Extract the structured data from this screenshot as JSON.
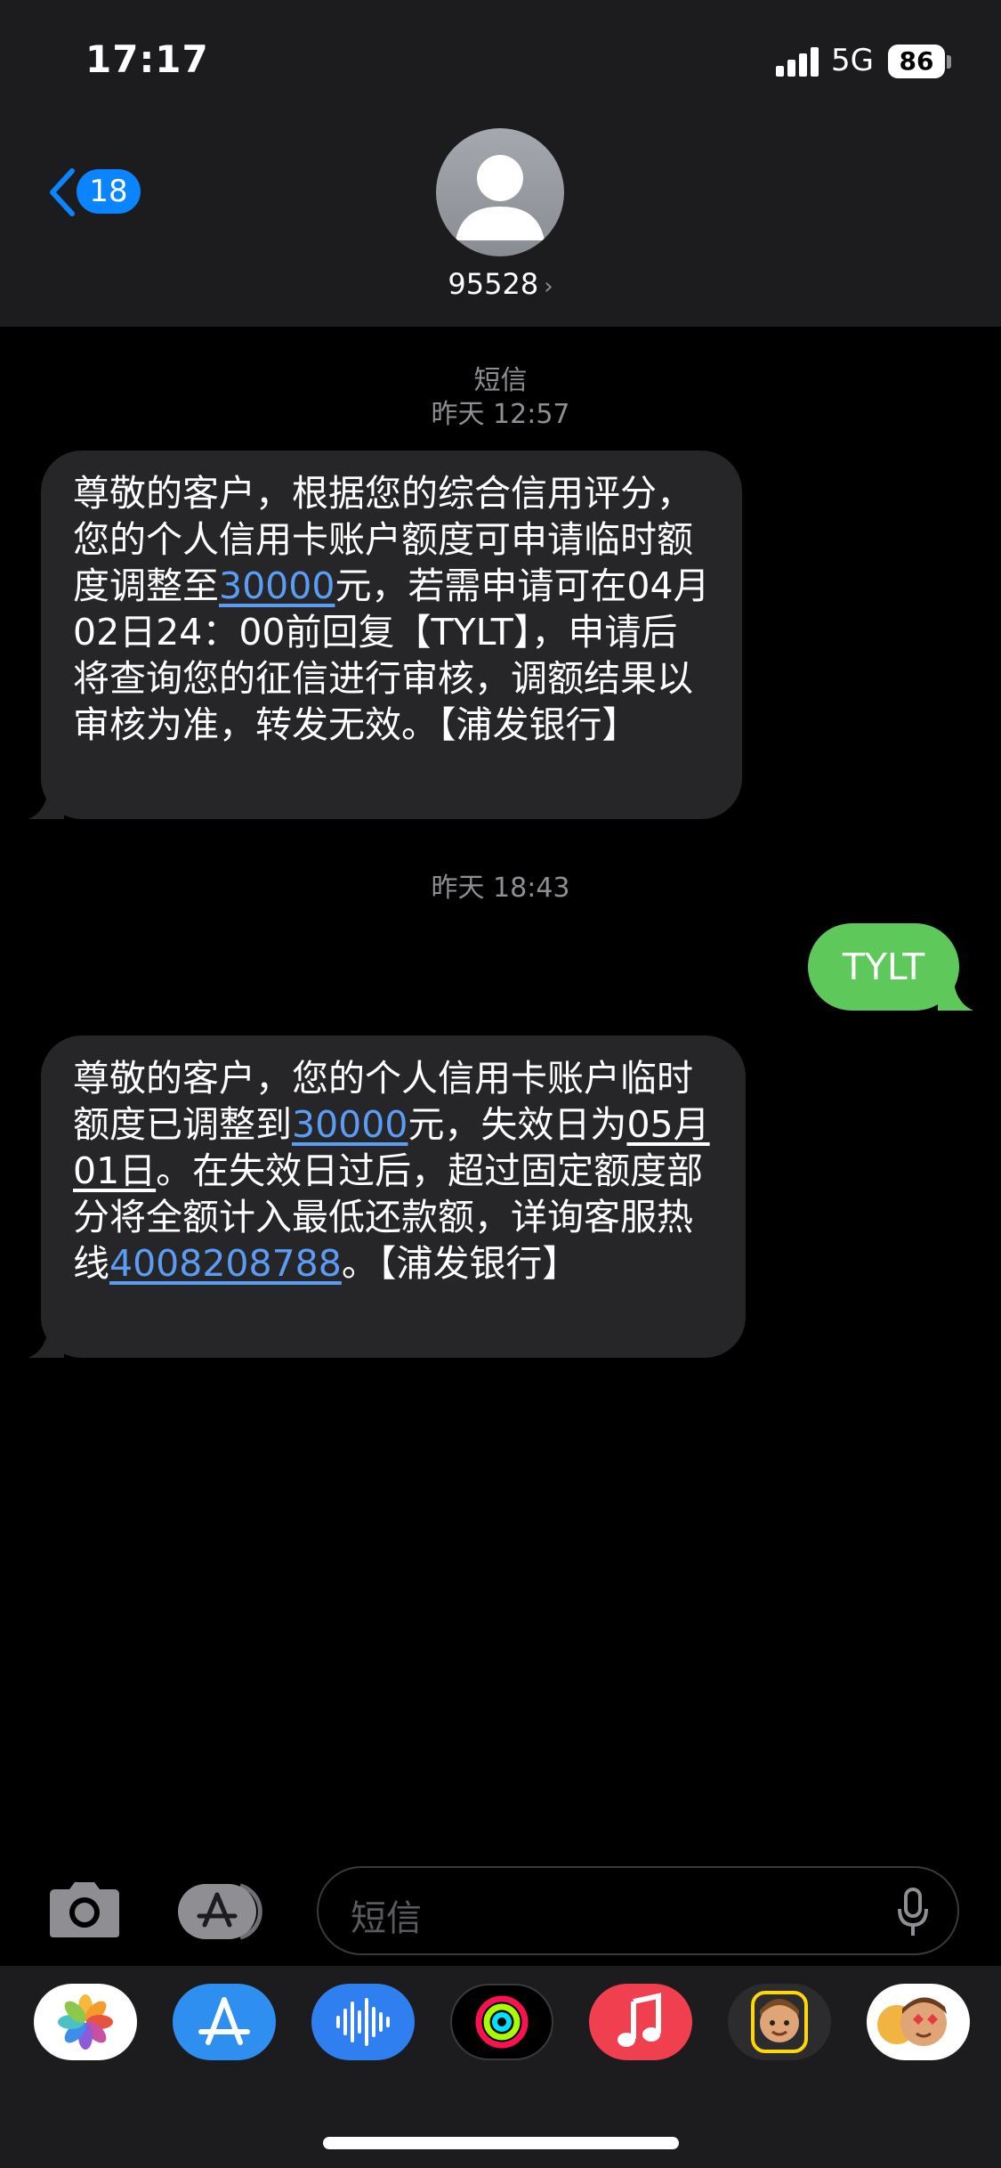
{
  "status_bar": {
    "time": "17:17",
    "network": "5G",
    "battery": "86"
  },
  "header": {
    "back_count": "18",
    "contact_name": "95528",
    "contact_chevron": "›"
  },
  "thread": {
    "service_label": "短信",
    "timestamp_1": "昨天 12:57",
    "message_1": {
      "p1": "尊敬的客户，根据您的综合信用评分，您的个人信用卡账户额度可申请临时额度调整至",
      "amount": "30000",
      "p2": "元，若需申请可在04月02日24：00前回复【TYLT】，申请后将查询您的征信进行审核，调额结果以审核为准，转发无效。【浦发银行】"
    },
    "timestamp_2": "昨天 18:43",
    "message_2": {
      "text": "TYLT"
    },
    "message_3": {
      "p1": "尊敬的客户，您的个人信用卡账户临时额度已调整到",
      "amount": "30000",
      "p2": "元，失效日为",
      "date": "05月01日",
      "p3": "。在失效日过后，超过固定额度部分将全额计入最低还款额，详询客服热线",
      "phone": "4008208788",
      "p4": "。【浦发银行】"
    }
  },
  "input_bar": {
    "placeholder": "短信"
  },
  "app_drawer": {
    "apps": [
      "photos-icon",
      "app-store-icon",
      "audio-messages-icon",
      "fitness-icon",
      "music-icon",
      "memoji-icon",
      "animoji-icon"
    ]
  },
  "colors": {
    "incoming_bubble": "#262629",
    "outgoing_bubble": "#5ec85b",
    "link": "#5b9cf5",
    "accent": "#0a84ff",
    "header_bg": "#1c1c1e"
  }
}
